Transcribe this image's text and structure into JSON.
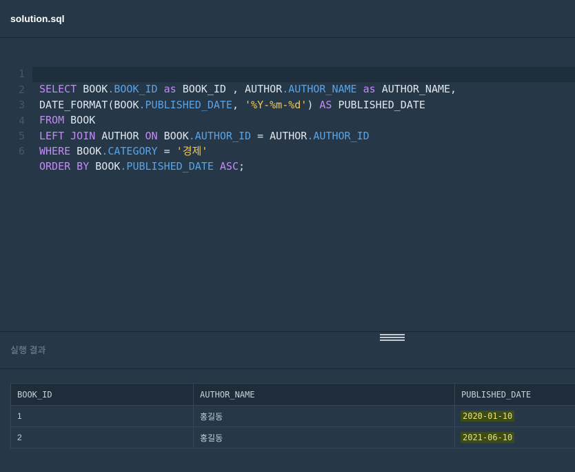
{
  "tab": {
    "filename": "solution.sql"
  },
  "editor": {
    "lines": [
      {
        "num": "1",
        "tokens": [
          {
            "t": "SELECT",
            "c": "kw"
          },
          {
            "t": " BOOK",
            "c": ""
          },
          {
            "t": ".BOOK_ID",
            "c": "fld"
          },
          {
            "t": " as",
            "c": "kw"
          },
          {
            "t": " BOOK_ID , AUTHOR",
            "c": ""
          },
          {
            "t": ".AUTHOR_NAME",
            "c": "fld"
          },
          {
            "t": " as",
            "c": "kw"
          },
          {
            "t": " AUTHOR_NAME,",
            "c": ""
          }
        ]
      },
      {
        "num": "2",
        "tokens": [
          {
            "t": "DATE_FORMAT(BOOK",
            "c": ""
          },
          {
            "t": ".PUBLISHED_DATE",
            "c": "fld"
          },
          {
            "t": ", ",
            "c": ""
          },
          {
            "t": "'%Y-%m-%d'",
            "c": "str"
          },
          {
            "t": ") ",
            "c": ""
          },
          {
            "t": "AS",
            "c": "kw"
          },
          {
            "t": " PUBLISHED_DATE",
            "c": ""
          }
        ]
      },
      {
        "num": "3",
        "tokens": [
          {
            "t": "FROM",
            "c": "kw"
          },
          {
            "t": " BOOK",
            "c": ""
          }
        ]
      },
      {
        "num": "4",
        "tokens": [
          {
            "t": "LEFT JOIN",
            "c": "kw"
          },
          {
            "t": " AUTHOR ",
            "c": ""
          },
          {
            "t": "ON",
            "c": "kw"
          },
          {
            "t": " BOOK",
            "c": ""
          },
          {
            "t": ".AUTHOR_ID",
            "c": "fld"
          },
          {
            "t": " = AUTHOR",
            "c": ""
          },
          {
            "t": ".AUTHOR_ID",
            "c": "fld"
          }
        ]
      },
      {
        "num": "5",
        "tokens": [
          {
            "t": "WHERE",
            "c": "kw"
          },
          {
            "t": " BOOK",
            "c": ""
          },
          {
            "t": ".CATEGORY",
            "c": "fld"
          },
          {
            "t": " = ",
            "c": ""
          },
          {
            "t": "'경제'",
            "c": "str"
          }
        ]
      },
      {
        "num": "6",
        "tokens": [
          {
            "t": "ORDER BY",
            "c": "kw"
          },
          {
            "t": " BOOK",
            "c": ""
          },
          {
            "t": ".PUBLISHED_DATE",
            "c": "fld"
          },
          {
            "t": " ",
            "c": ""
          },
          {
            "t": "ASC",
            "c": "kw"
          },
          {
            "t": ";",
            "c": ""
          }
        ]
      }
    ]
  },
  "results": {
    "title": "실행 결과",
    "columns": [
      "BOOK_ID",
      "AUTHOR_NAME",
      "PUBLISHED_DATE"
    ],
    "rows": [
      [
        "1",
        "홍길동",
        "2020-01-10"
      ],
      [
        "2",
        "홍길동",
        "2021-06-10"
      ]
    ]
  }
}
